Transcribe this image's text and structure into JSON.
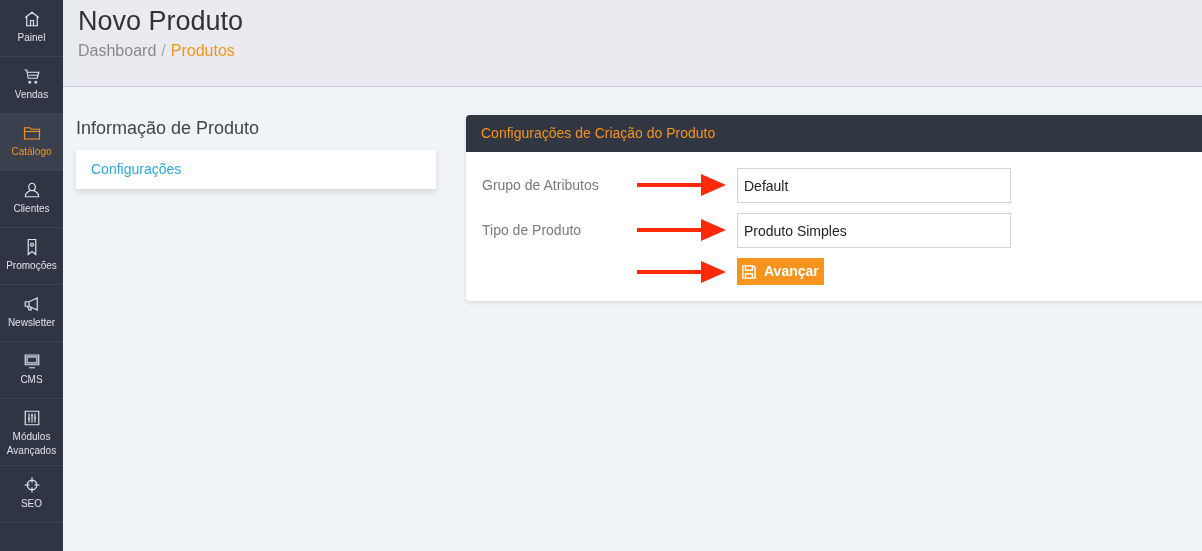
{
  "sidebar": {
    "items": [
      {
        "label": "Painel",
        "selected": false
      },
      {
        "label": "Vendas",
        "selected": false
      },
      {
        "label": "Catálogo",
        "selected": true
      },
      {
        "label": "Clientes",
        "selected": false
      },
      {
        "label": "Promoções",
        "selected": false
      },
      {
        "label": "Newsletter",
        "selected": false
      },
      {
        "label": "CMS",
        "selected": false
      },
      {
        "label": "Módulos Avançados",
        "selected": false
      },
      {
        "label": "SEO",
        "selected": false
      }
    ]
  },
  "header": {
    "title": "Novo Produto",
    "separator": "/",
    "breadcrumb": [
      {
        "label": "Dashboard",
        "selected": false
      },
      {
        "label": "Produtos",
        "selected": true
      }
    ]
  },
  "left": {
    "title": "Informação de Produto",
    "links": [
      "Configurações"
    ]
  },
  "panel": {
    "title": "Configurações de Criação do Produto",
    "rows": [
      {
        "kind": "input",
        "label": "Grupo de Atributos",
        "value": "Default",
        "marked": true
      },
      {
        "kind": "input",
        "label": "Tipo de Produto",
        "value": "Produto Simples",
        "marked": true
      },
      {
        "kind": "button",
        "label": "Avançar",
        "marked": true
      }
    ]
  }
}
